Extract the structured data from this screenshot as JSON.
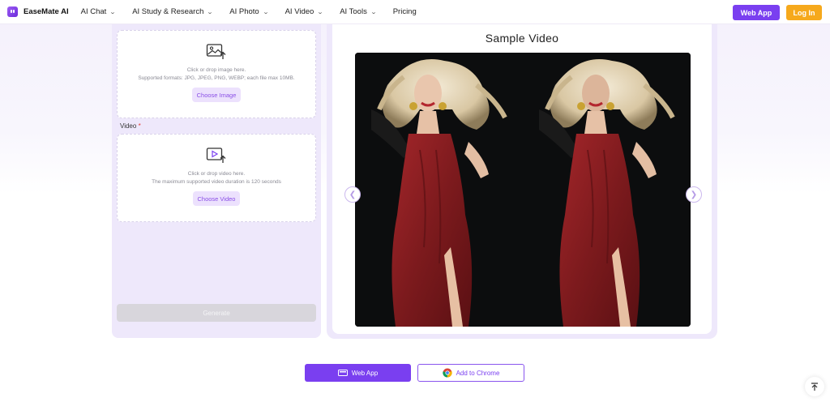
{
  "header": {
    "brand": "EaseMate AI",
    "nav": [
      {
        "label": "AI Chat",
        "has_dropdown": true
      },
      {
        "label": "AI Study & Research",
        "has_dropdown": true
      },
      {
        "label": "AI Photo",
        "has_dropdown": true
      },
      {
        "label": "AI Video",
        "has_dropdown": true
      },
      {
        "label": "AI Tools",
        "has_dropdown": true
      },
      {
        "label": "Pricing",
        "has_dropdown": false
      }
    ],
    "web_app_label": "Web App",
    "login_label": "Log In"
  },
  "left_panel": {
    "image_section": {
      "hint": "Click or drop image here.",
      "formats": "Supported formats: JPG, JPEG, PNG, WEBP; each file max 10MB.",
      "button_label": "Choose Image"
    },
    "video_section": {
      "label": "Video",
      "required_mark": "*",
      "hint": "Click or drop video here.",
      "duration_note": "The maximum supported video duration is 120 seconds",
      "button_label": "Choose Video"
    },
    "generate_label": "Generate"
  },
  "preview": {
    "title": "Sample Video",
    "prev_icon": "chevron-left-icon",
    "next_icon": "chevron-right-icon"
  },
  "bottom": {
    "web_app_label": "Web App",
    "chrome_label": "Add to Chrome"
  },
  "colors": {
    "brand_purple": "#7a3ff0",
    "login_orange": "#f6a91c",
    "panel_lavender": "#eee8fb",
    "dress_red": "#8a1d1f"
  }
}
